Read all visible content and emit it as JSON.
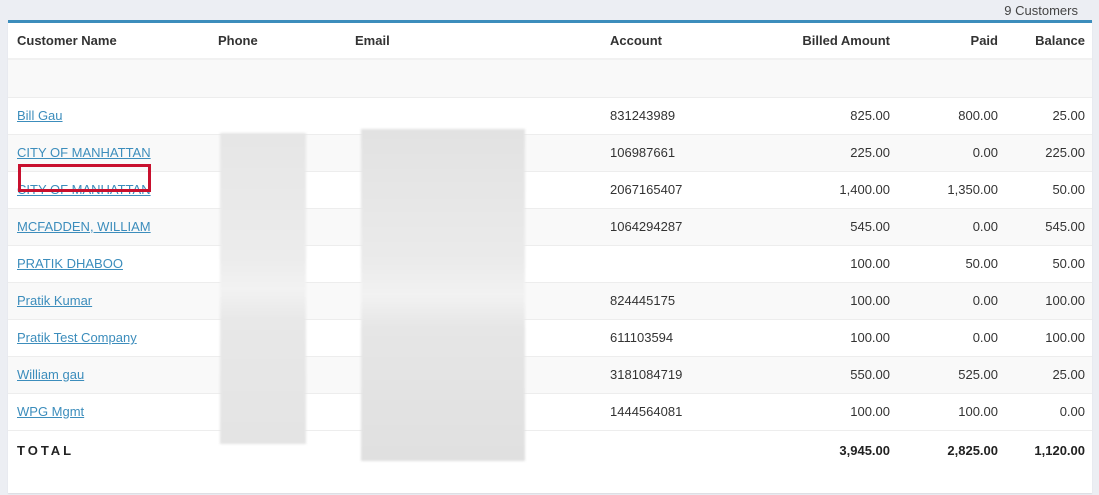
{
  "summary": {
    "count_text": "9 Customers"
  },
  "table": {
    "columns": {
      "name": "Customer Name",
      "phone": "Phone",
      "email": "Email",
      "account": "Account",
      "billed": "Billed Amount",
      "paid": "Paid",
      "balance": "Balance"
    },
    "rows": [
      {
        "name": "Bill Gau",
        "account": "831243989",
        "billed": "825.00",
        "paid": "800.00",
        "balance": "25.00"
      },
      {
        "name": "CITY OF MANHATTAN",
        "account": "106987661",
        "billed": "225.00",
        "paid": "0.00",
        "balance": "225.00"
      },
      {
        "name": "CITY OF MANHATTAN",
        "account": "2067165407",
        "billed": "1,400.00",
        "paid": "1,350.00",
        "balance": "50.00"
      },
      {
        "name": "MCFADDEN, WILLIAM",
        "account": "1064294287",
        "billed": "545.00",
        "paid": "0.00",
        "balance": "545.00"
      },
      {
        "name": "PRATIK DHABOO",
        "account": "",
        "billed": "100.00",
        "paid": "50.00",
        "balance": "50.00"
      },
      {
        "name": "Pratik Kumar",
        "account": "824445175",
        "billed": "100.00",
        "paid": "0.00",
        "balance": "100.00"
      },
      {
        "name": "Pratik Test Company",
        "account": "611103594",
        "billed": "100.00",
        "paid": "0.00",
        "balance": "100.00"
      },
      {
        "name": "William gau",
        "account": "3181084719",
        "billed": "550.00",
        "paid": "525.00",
        "balance": "25.00"
      },
      {
        "name": "WPG Mgmt",
        "account": "1444564081",
        "billed": "100.00",
        "paid": "100.00",
        "balance": "0.00"
      }
    ],
    "total": {
      "label": "TOTAL",
      "billed": "3,945.00",
      "paid": "2,825.00",
      "balance": "1,120.00"
    }
  },
  "colors": {
    "accent": "#3c8dbc",
    "highlight": "#c8102e"
  }
}
